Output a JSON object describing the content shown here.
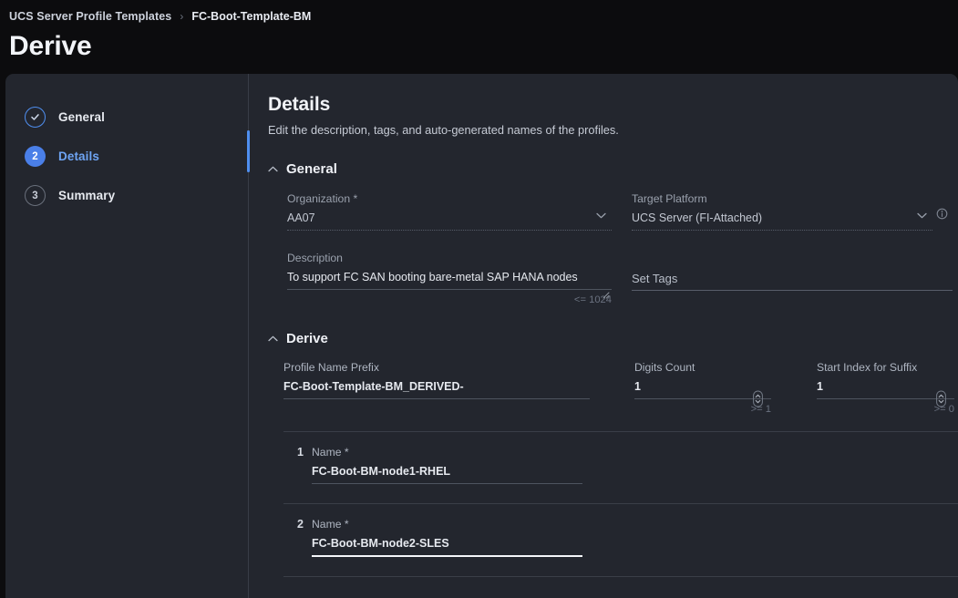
{
  "breadcrumb": {
    "parent": "UCS Server Profile Templates",
    "separator": "›",
    "current": "FC-Boot-Template-BM"
  },
  "page": {
    "title": "Derive"
  },
  "wizard": {
    "steps": [
      {
        "badge": "✓",
        "label": "General",
        "state": "done"
      },
      {
        "badge": "2",
        "label": "Details",
        "state": "active"
      },
      {
        "badge": "3",
        "label": "Summary",
        "state": "todo"
      }
    ]
  },
  "details": {
    "title": "Details",
    "subtitle": "Edit the description, tags, and auto-generated names of the profiles."
  },
  "general": {
    "heading": "General",
    "organization": {
      "label": "Organization *",
      "value": "AA07"
    },
    "target_platform": {
      "label": "Target Platform",
      "value": "UCS Server (FI-Attached)"
    },
    "description": {
      "label": "Description",
      "value": "To support FC SAN booting bare-metal SAP HANA nodes",
      "hint": "<= 1024"
    },
    "set_tags": {
      "label": "Set Tags",
      "value": ""
    }
  },
  "derive": {
    "heading": "Derive",
    "profile_name_prefix": {
      "label": "Profile Name Prefix",
      "value": "FC-Boot-Template-BM_DERIVED-"
    },
    "digits_count": {
      "label": "Digits Count",
      "value": "1",
      "hint": ">= 1"
    },
    "start_index": {
      "label": "Start Index for Suffix",
      "value": "1",
      "hint": ">= 0"
    },
    "profiles": [
      {
        "index": "1",
        "label": "Name *",
        "value": "FC-Boot-BM-node1-RHEL",
        "focused": false
      },
      {
        "index": "2",
        "label": "Name *",
        "value": "FC-Boot-BM-node2-SLES",
        "focused": true
      }
    ]
  },
  "colors": {
    "accent": "#4a7fe8",
    "accent_link": "#6ea4f3",
    "card_bg": "#23262e",
    "page_bg": "#0c0c0e"
  }
}
